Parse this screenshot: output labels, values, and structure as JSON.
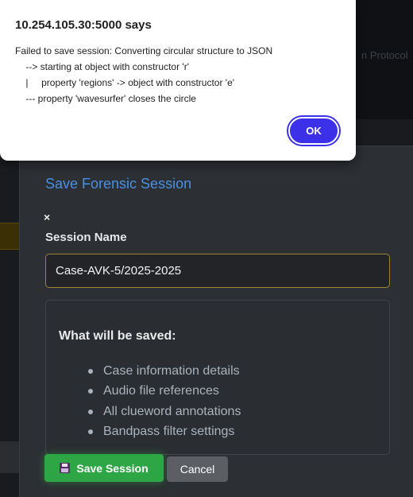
{
  "alert": {
    "origin": "10.254.105.30:5000 says",
    "message": "Failed to save session: Converting circular structure to JSON\n    --> starting at object with constructor 'r'\n    |     property 'regions' -> object with constructor 'e'\n    --- property 'wavesurfer' closes the circle",
    "ok_label": "OK"
  },
  "background": {
    "ghost_text": "n Protocol"
  },
  "modal": {
    "title": "Save Forensic Session",
    "close_glyph": "×",
    "field_label": "Session Name",
    "session_name_value": "Case-AVK-5/2025-2025",
    "info_heading": "What will be saved:",
    "info_items": [
      "Case information details",
      "Audio file references",
      "All clueword annotations",
      "Bandpass filter settings"
    ],
    "save_label": "Save Session",
    "save_icon": "floppy-disk-icon",
    "cancel_label": "Cancel"
  },
  "colors": {
    "title_blue": "#4a90e2",
    "save_green": "#2fa646",
    "ok_button": "#3c31e8",
    "input_border": "#9c8632"
  }
}
